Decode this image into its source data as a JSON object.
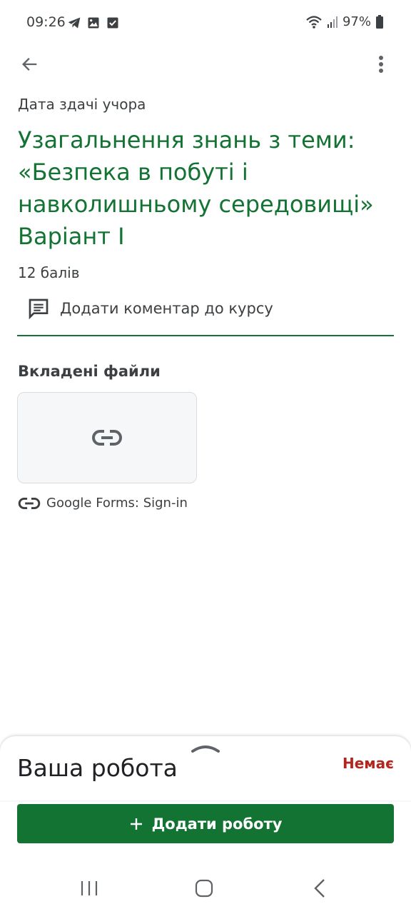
{
  "status_bar": {
    "time": "09:26",
    "battery": "97%",
    "icons": [
      "telegram-icon",
      "gallery-icon",
      "checkbox-icon",
      "wifi-icon",
      "signal-icon",
      "battery-icon"
    ]
  },
  "app_bar": {
    "back_icon": "arrow-left-icon",
    "more_icon": "more-vert-icon"
  },
  "assignment": {
    "due": "Дата здачі учора",
    "title": "Узагальнення знань з теми: «Безпека в побуті і навколишньому середовищі» Варіант І",
    "points": "12 балів",
    "comment_label": "Додати коментар до курсу"
  },
  "attachments": {
    "heading": "Вкладені файли",
    "items": [
      {
        "label": "Google Forms: Sign-in",
        "icon": "link-icon"
      }
    ]
  },
  "your_work": {
    "title": "Ваша робота",
    "status": "Немає",
    "add_button_label": "Додати роботу"
  },
  "colors": {
    "accent": "#137333",
    "status_red": "#b3261e",
    "text": "#3c4043"
  }
}
